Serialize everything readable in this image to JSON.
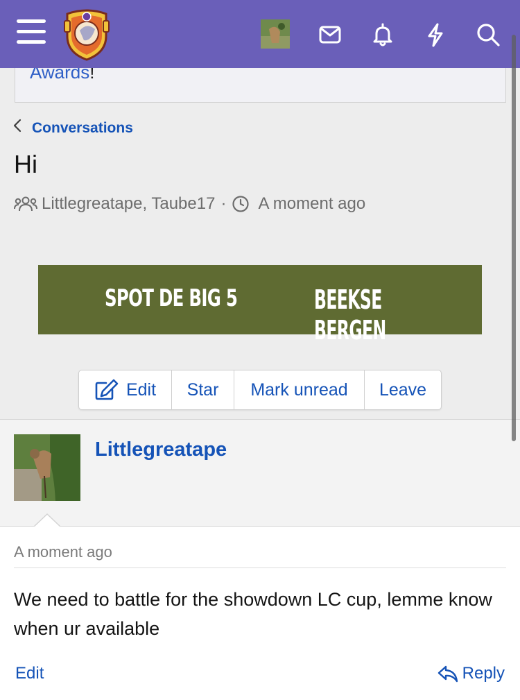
{
  "header": {
    "menu_icon": "hamburger-icon",
    "logo_icon": "site-crest-logo",
    "avatar_icon": "user-avatar",
    "icons": [
      "envelope-icon",
      "bell-icon",
      "lightning-icon",
      "search-icon"
    ]
  },
  "notice": {
    "text": "Awards",
    "suffix": "!"
  },
  "breadcrumb": {
    "label": "Conversations"
  },
  "conversation": {
    "title": "Hi",
    "participants": "Littlegreatape, Taube17",
    "separator": "·",
    "time": "A moment ago"
  },
  "ad": {
    "left_text": "SPOT DE BIG 5",
    "right_text": "BEEKSE BERGEN"
  },
  "actions": {
    "edit": "Edit",
    "star": "Star",
    "mark_unread": "Mark unread",
    "leave": "Leave"
  },
  "message": {
    "author": "Littlegreatape",
    "time": "A moment ago",
    "text": "We need to battle for the showdown LC cup, lemme know when ur available",
    "edit_label": "Edit",
    "reply_label": "Reply"
  },
  "colors": {
    "header": "#6a5fb9",
    "link": "#1553b7",
    "ad_bg": "#5f6b32"
  }
}
